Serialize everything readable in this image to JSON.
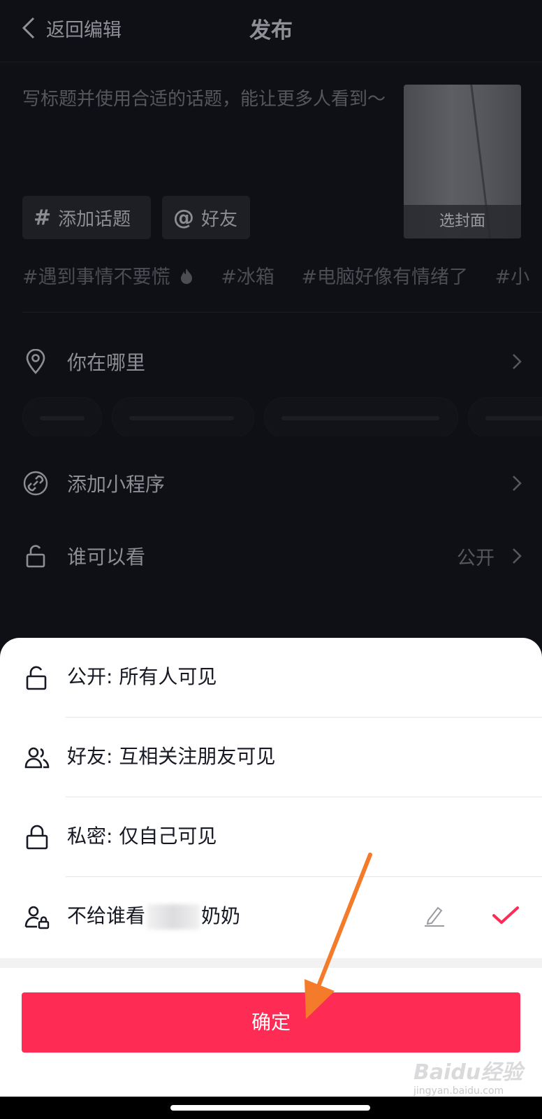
{
  "header": {
    "back_label": "返回编辑",
    "title": "发布"
  },
  "caption": {
    "placeholder": "写标题并使用合适的话题，能让更多人看到～"
  },
  "cover": {
    "label": "选封面"
  },
  "chips": [
    {
      "symbol": "#",
      "label": "添加话题"
    },
    {
      "symbol": "@",
      "label": "好友"
    }
  ],
  "topics": [
    "#遇到事情不要慌",
    "#冰箱",
    "#电脑好像有情绪了",
    "#小"
  ],
  "rows": {
    "location": {
      "label": "你在哪里"
    },
    "miniapp": {
      "label": "添加小程序"
    },
    "visibility": {
      "label": "谁可以看",
      "value": "公开"
    }
  },
  "sheet": {
    "options": [
      {
        "label": "公开: 所有人可见",
        "icon": "unlock-icon"
      },
      {
        "label": "好友: 互相关注朋友可见",
        "icon": "friends-icon"
      },
      {
        "label": "私密: 仅自己可见",
        "icon": "lock-icon"
      },
      {
        "label_prefix": "不给谁看",
        "label_suffix": "奶奶",
        "icon": "user-lock-icon",
        "selected": true
      }
    ],
    "confirm_label": "确定"
  },
  "watermark": {
    "brand": "Baidu经验",
    "url": "jingyan.baidu.com"
  },
  "colors": {
    "accent": "#fe2c55",
    "arrow": "#f47b2a",
    "background": "#0f1016"
  }
}
